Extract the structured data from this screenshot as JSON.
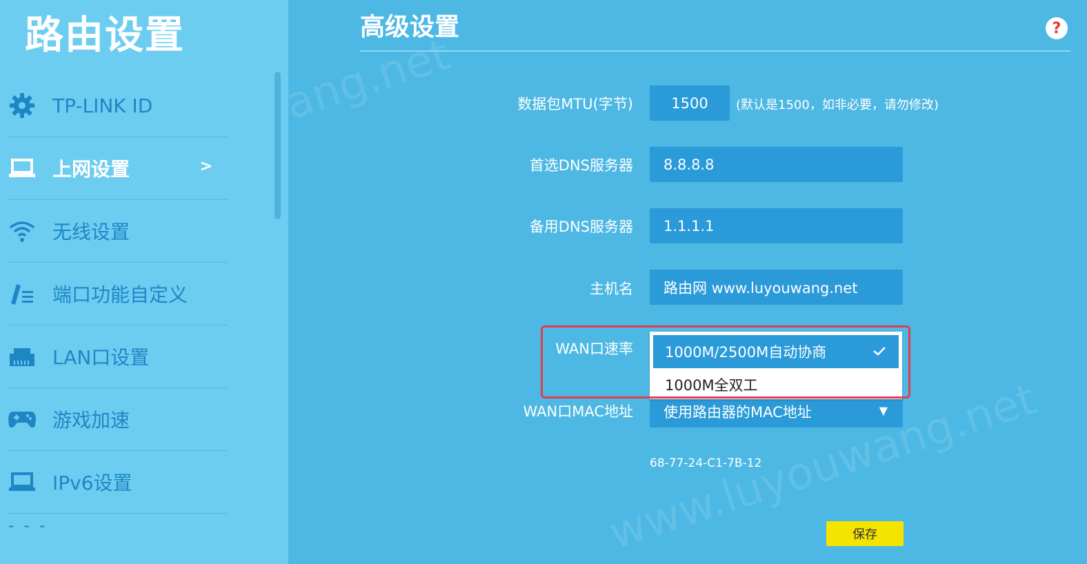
{
  "sidebar": {
    "title": "路由设置",
    "items": [
      {
        "label": "TP-LINK ID",
        "icon": "gear-icon"
      },
      {
        "label": "上网设置",
        "icon": "laptop-icon",
        "active": true,
        "chevron": ">"
      },
      {
        "label": "无线设置",
        "icon": "wifi-icon"
      },
      {
        "label": "端口功能自定义",
        "icon": "edit-list-icon"
      },
      {
        "label": "LAN口设置",
        "icon": "lan-port-icon"
      },
      {
        "label": "游戏加速",
        "icon": "gamepad-icon"
      },
      {
        "label": "IPv6设置",
        "icon": "laptop-icon"
      }
    ],
    "more": "- - -"
  },
  "main": {
    "title": "高级设置",
    "help": "?",
    "fields": {
      "mtu": {
        "label": "数据包MTU(字节)",
        "value": "1500",
        "hint": "(默认是1500，如非必要，请勿修改)"
      },
      "dns_primary": {
        "label": "首选DNS服务器",
        "value": "8.8.8.8"
      },
      "dns_secondary": {
        "label": "备用DNS服务器",
        "value": "1.1.1.1"
      },
      "hostname": {
        "label": "主机名",
        "value": "路由网 www.luyouwang.net"
      },
      "wan_speed": {
        "label": "WAN口速率",
        "selected": "1000M/2500M自动协商",
        "options": [
          "1000M全双工"
        ]
      },
      "wan_mac": {
        "label": "WAN口MAC地址",
        "selected": "使用路由器的MAC地址",
        "mac": "68-77-24-C1-7B-12"
      }
    },
    "save_label": "保存"
  },
  "watermark": "www.luyouwang.net",
  "colors": {
    "background": "#4cb8e3",
    "sidebar": "#6ccdf0",
    "input": "#2a9ad9",
    "accent_highlight": "#e43d4a",
    "save_button": "#f5e300"
  }
}
